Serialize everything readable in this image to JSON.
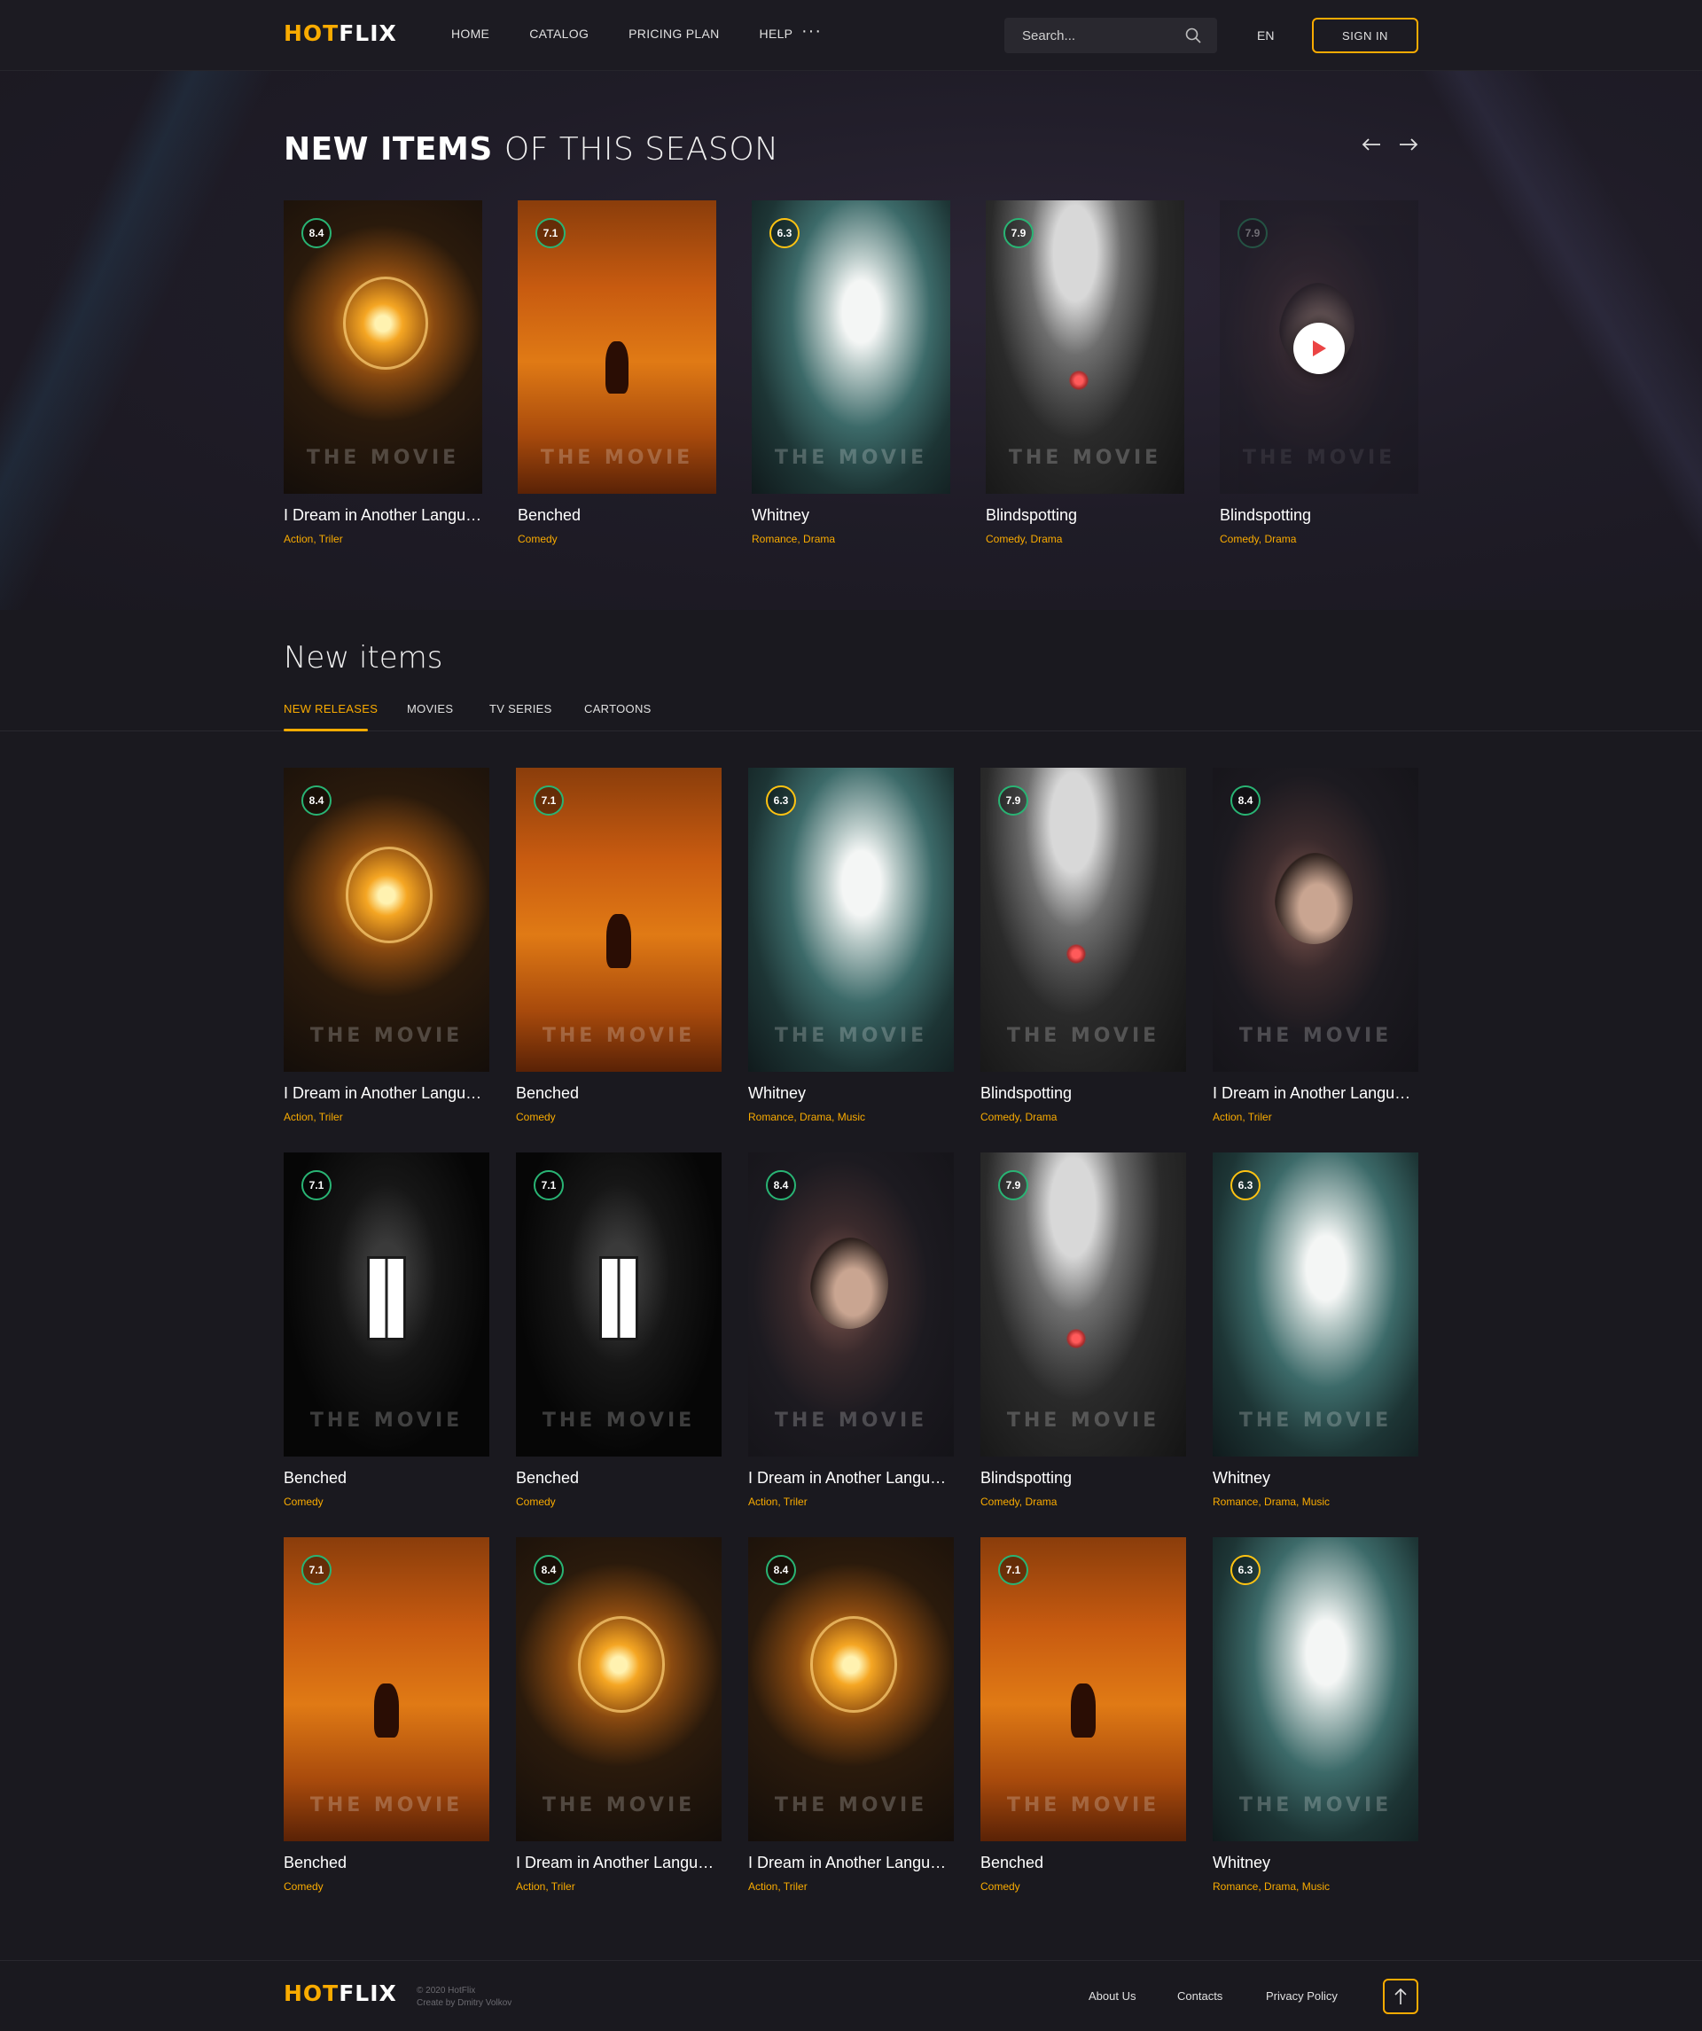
{
  "header": {
    "logo_hot": "HOT",
    "logo_flix": "FLIX",
    "nav": [
      "HOME",
      "CATALOG",
      "PRICING PLAN",
      "HELP"
    ],
    "more": "···",
    "search_placeholder": "Search...",
    "lang": "EN",
    "signin": "SIGN IN"
  },
  "hero": {
    "title_bold": "NEW ITEMS",
    "title_light": "OF THIS SEASON",
    "watermark": "THE MOVIE",
    "cards": [
      {
        "rating": "8.4",
        "title": "I Dream in Another Language",
        "genres": "Action,  Triler",
        "art": "fire"
      },
      {
        "rating": "7.1",
        "title": "Benched",
        "genres": "Comedy",
        "art": "horse"
      },
      {
        "rating": "6.3",
        "title": "Whitney",
        "genres": "Romance,  Drama",
        "art": "cave"
      },
      {
        "rating": "7.9",
        "title": "Blindspotting",
        "genres": "Comedy,  Drama",
        "art": "smoke"
      },
      {
        "rating": "7.9",
        "title": "Blindspotting",
        "genres": "Comedy,  Drama",
        "art": "woman"
      }
    ]
  },
  "new_items": {
    "title": "New items",
    "tabs": [
      "NEW RELEASES",
      "MOVIES",
      "TV SERIES",
      "CARTOONS"
    ],
    "watermark": "THE MOVIE",
    "grid": [
      {
        "rating": "8.4",
        "title": "I Dream in Another Language",
        "genres": "Action,  Triler",
        "art": "fire"
      },
      {
        "rating": "7.1",
        "title": "Benched",
        "genres": "Comedy",
        "art": "horse"
      },
      {
        "rating": "6.3",
        "title": "Whitney",
        "genres": "Romance,  Drama,  Music",
        "art": "cave"
      },
      {
        "rating": "7.9",
        "title": "Blindspotting",
        "genres": "Comedy,  Drama",
        "art": "smoke"
      },
      {
        "rating": "8.4",
        "title": "I Dream in Another Language",
        "genres": "Action,  Triler",
        "art": "woman"
      },
      {
        "rating": "7.1",
        "title": "Benched",
        "genres": "Comedy",
        "art": "window"
      },
      {
        "rating": "7.1",
        "title": "Benched",
        "genres": "Comedy",
        "art": "window"
      },
      {
        "rating": "8.4",
        "title": "I Dream in Another Language",
        "genres": "Action,  Triler",
        "art": "woman"
      },
      {
        "rating": "7.9",
        "title": "Blindspotting",
        "genres": "Comedy,  Drama",
        "art": "smoke"
      },
      {
        "rating": "6.3",
        "title": "Whitney",
        "genres": "Romance,  Drama,  Music",
        "art": "cave"
      },
      {
        "rating": "7.1",
        "title": "Benched",
        "genres": "Comedy",
        "art": "horse"
      },
      {
        "rating": "8.4",
        "title": "I Dream in Another Language",
        "genres": "Action,  Triler",
        "art": "fire"
      },
      {
        "rating": "8.4",
        "title": "I Dream in Another Language",
        "genres": "Action,  Triler",
        "art": "fire"
      },
      {
        "rating": "7.1",
        "title": "Benched",
        "genres": "Comedy",
        "art": "horse"
      },
      {
        "rating": "6.3",
        "title": "Whitney",
        "genres": "Romance,  Drama,  Music",
        "art": "cave"
      }
    ]
  },
  "footer": {
    "logo_hot": "HOT",
    "logo_flix": "FLIX",
    "copyright": "© 2020 HotFlix",
    "credit": "Create by Dmitry Volkov",
    "links": [
      "About Us",
      "Contacts",
      "Privacy Policy"
    ]
  },
  "colors": {
    "accent": "#f9ab00",
    "rating_high": "#29b474",
    "bg": "#1a191f"
  }
}
